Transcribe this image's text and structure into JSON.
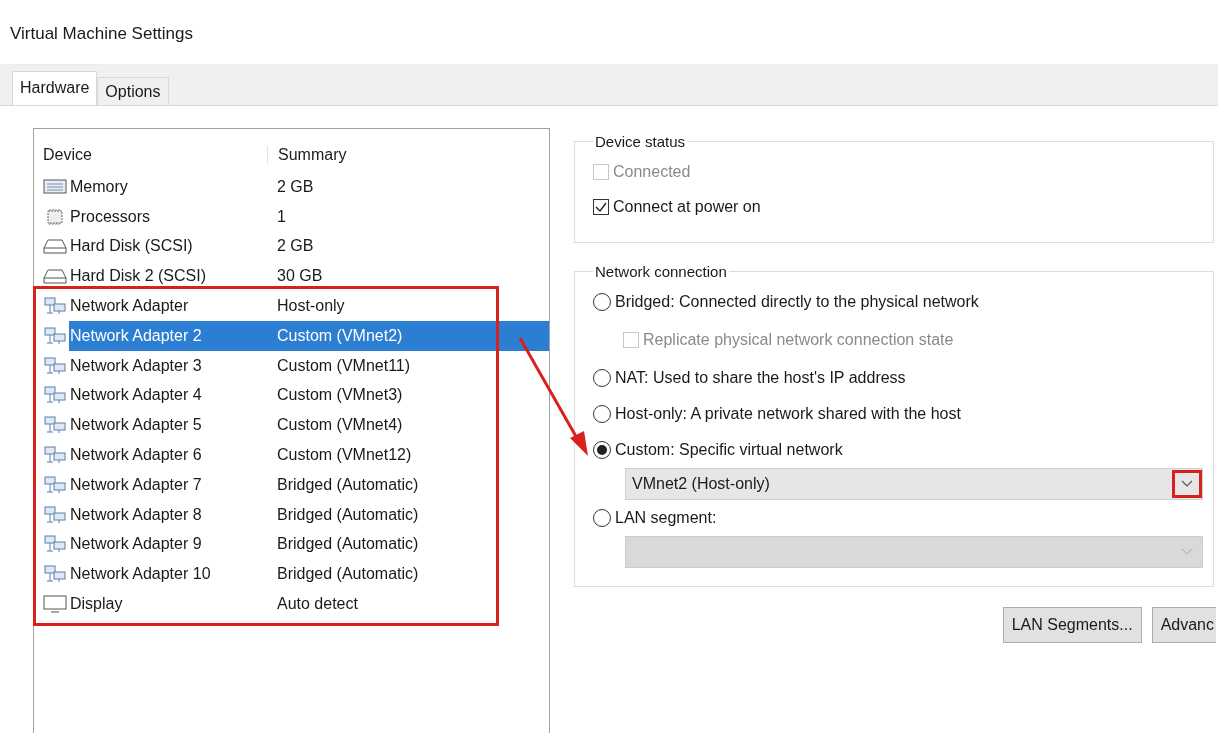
{
  "window": {
    "title": "Virtual Machine Settings"
  },
  "tabs": [
    {
      "label": "Hardware",
      "selected": true
    },
    {
      "label": "Options",
      "selected": false
    }
  ],
  "device_list": {
    "columns": [
      "Device",
      "Summary"
    ],
    "rows": [
      {
        "kind": "memory",
        "device": "Memory",
        "summary": "2 GB",
        "selected": false
      },
      {
        "kind": "processor",
        "device": "Processors",
        "summary": "1",
        "selected": false
      },
      {
        "kind": "disk",
        "device": "Hard Disk (SCSI)",
        "summary": "2 GB",
        "selected": false
      },
      {
        "kind": "disk",
        "device": "Hard Disk 2 (SCSI)",
        "summary": "30 GB",
        "selected": false
      },
      {
        "kind": "network",
        "device": "Network Adapter",
        "summary": "Host-only",
        "selected": false
      },
      {
        "kind": "network",
        "device": "Network Adapter 2",
        "summary": "Custom (VMnet2)",
        "selected": true
      },
      {
        "kind": "network",
        "device": "Network Adapter 3",
        "summary": "Custom (VMnet11)",
        "selected": false
      },
      {
        "kind": "network",
        "device": "Network Adapter 4",
        "summary": "Custom (VMnet3)",
        "selected": false
      },
      {
        "kind": "network",
        "device": "Network Adapter 5",
        "summary": "Custom (VMnet4)",
        "selected": false
      },
      {
        "kind": "network",
        "device": "Network Adapter 6",
        "summary": "Custom (VMnet12)",
        "selected": false
      },
      {
        "kind": "network",
        "device": "Network Adapter 7",
        "summary": "Bridged (Automatic)",
        "selected": false
      },
      {
        "kind": "network",
        "device": "Network Adapter 8",
        "summary": "Bridged (Automatic)",
        "selected": false
      },
      {
        "kind": "network",
        "device": "Network Adapter 9",
        "summary": "Bridged (Automatic)",
        "selected": false
      },
      {
        "kind": "network",
        "device": "Network Adapter 10",
        "summary": "Bridged (Automatic)",
        "selected": false
      },
      {
        "kind": "display",
        "device": "Display",
        "summary": "Auto detect",
        "selected": false
      }
    ]
  },
  "device_status": {
    "title": "Device status",
    "checkboxes": [
      {
        "label": "Connected",
        "checked": false,
        "disabled": true
      },
      {
        "label": "Connect at power on",
        "checked": true,
        "disabled": false
      }
    ]
  },
  "network_connection": {
    "title": "Network connection",
    "options": [
      {
        "label": "Bridged: Connected directly to the physical network",
        "selected": false,
        "sub": {
          "kind": "checkbox",
          "label": "Replicate physical network connection state",
          "checked": false,
          "disabled": true
        }
      },
      {
        "label": "NAT: Used to share the host's IP address",
        "selected": false
      },
      {
        "label": "Host-only: A private network shared with the host",
        "selected": false
      },
      {
        "label": "Custom: Specific virtual network",
        "selected": true,
        "sub": {
          "kind": "dropdown",
          "value": "VMnet2 (Host-only)",
          "disabled": false
        }
      },
      {
        "label": "LAN segment:",
        "selected": false,
        "sub": {
          "kind": "dropdown",
          "disabled": true
        }
      }
    ]
  },
  "buttons": [
    "LAN Segments...",
    "Advanc"
  ]
}
